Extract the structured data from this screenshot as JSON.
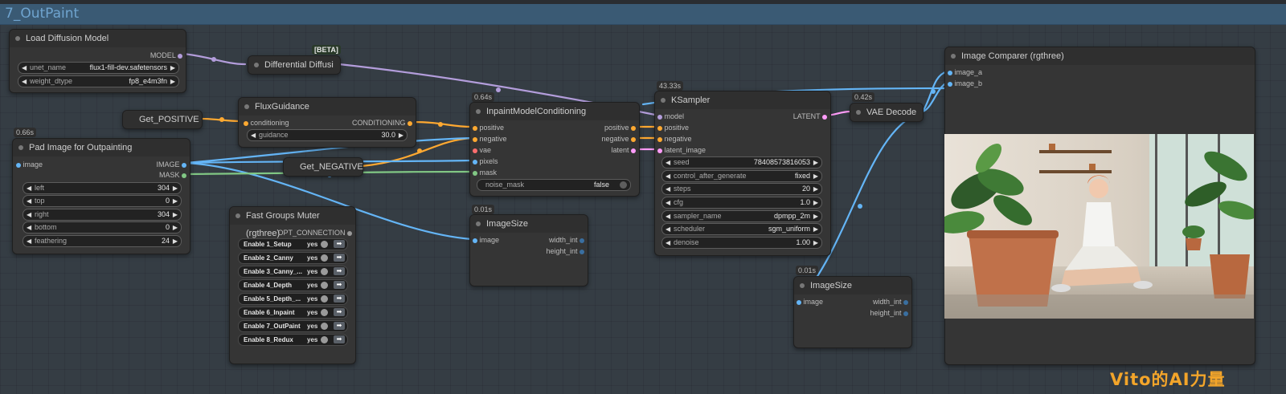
{
  "group": {
    "title": "7_OutPaint"
  },
  "load_diffusion": {
    "title": "Load Diffusion Model",
    "output": "MODEL",
    "unet_label": "unet_name",
    "unet_value": "flux1-fill-dev.safetensors",
    "dtype_label": "weight_dtype",
    "dtype_value": "fp8_e4m3fn"
  },
  "differential": {
    "title": "Differential Diffusi",
    "badge": "[BETA]"
  },
  "get_positive": {
    "title": "Get_POSITIVE"
  },
  "get_negative": {
    "title": "Get_NEGATIVE"
  },
  "flux_guidance": {
    "title": "FluxGuidance",
    "input": "conditioning",
    "output": "CONDITIONING",
    "guidance_label": "guidance",
    "guidance_value": "30.0"
  },
  "pad_image": {
    "title": "Pad Image for Outpainting",
    "badge": "0.66s",
    "input": "image",
    "out_image": "IMAGE",
    "out_mask": "MASK",
    "widgets": [
      {
        "label": "left",
        "value": "304"
      },
      {
        "label": "top",
        "value": "0"
      },
      {
        "label": "right",
        "value": "304"
      },
      {
        "label": "bottom",
        "value": "0"
      },
      {
        "label": "feathering",
        "value": "24"
      }
    ]
  },
  "inpaint": {
    "title": "InpaintModelConditioning",
    "badge": "0.64s",
    "inputs": [
      "positive",
      "negative",
      "vae",
      "pixels",
      "mask"
    ],
    "outputs": [
      "positive",
      "negative",
      "latent"
    ],
    "noise_label": "noise_mask",
    "noise_value": "false"
  },
  "imagesize1": {
    "title": "ImageSize",
    "badge": "0.01s",
    "input": "image",
    "out1": "width_int",
    "out2": "height_int"
  },
  "muter": {
    "title": "Fast Groups Muter (rgthree)",
    "output": "OPT_CONNECTION",
    "yes": "yes",
    "arrow": "➡",
    "rows": [
      "Enable 1_Setup",
      "Enable 2_Canny",
      "Enable 3_Canny_...",
      "Enable 4_Depth",
      "Enable 5_Depth_...",
      "Enable 6_Inpaint",
      "Enable 7_OutPaint",
      "Enable 8_Redux"
    ]
  },
  "ksampler": {
    "title": "KSampler",
    "badge": "43.33s",
    "inputs": [
      "model",
      "positive",
      "negative",
      "latent_image"
    ],
    "output": "LATENT",
    "widgets": [
      {
        "label": "seed",
        "value": "784085738160​53"
      },
      {
        "label": "control_after_generate",
        "value": "fixed"
      },
      {
        "label": "steps",
        "value": "20"
      },
      {
        "label": "cfg",
        "value": "1.0"
      },
      {
        "label": "sampler_name",
        "value": "dpmpp_2m"
      },
      {
        "label": "scheduler",
        "value": "sgm_uniform"
      },
      {
        "label": "denoise",
        "value": "1.00"
      }
    ]
  },
  "vae_decode": {
    "title": "VAE Decode",
    "badge": "0.42s"
  },
  "imagesize2": {
    "title": "ImageSize",
    "badge": "0.01s",
    "input": "image",
    "out1": "width_int",
    "out2": "height_int"
  },
  "comparer": {
    "title": "Image Comparer (rgthree)",
    "in1": "image_a",
    "in2": "image_b"
  },
  "watermark": "Vito的AI力量",
  "colors": {
    "model": "#b39ddb",
    "conditioning": "#ffa931",
    "image": "#64b5f6",
    "mask": "#81c784",
    "latent": "#ff9cf9",
    "vae": "#ff6e6e"
  }
}
